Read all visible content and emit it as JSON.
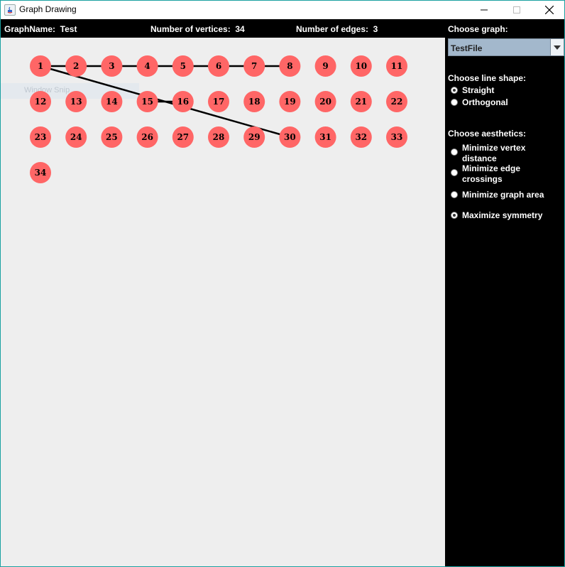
{
  "window": {
    "title": "Graph Drawing"
  },
  "info": {
    "graph_name": "GraphName:  Test",
    "vertices": "Number of vertices:  34",
    "edges": "Number of edges:  3"
  },
  "ghost": {
    "label": "Window Snip"
  },
  "panel": {
    "choose_graph": "Choose graph:",
    "graph_selected": "TestFile",
    "choose_line_shape": "Choose line shape:",
    "line_shapes": [
      {
        "label": "Straight",
        "checked": true
      },
      {
        "label": "Orthogonal",
        "checked": false
      }
    ],
    "choose_aesthetics": "Choose aesthetics:",
    "aesthetics": [
      {
        "label": "Minimize vertex distance",
        "checked": false
      },
      {
        "label": "Minimize edge crossings",
        "checked": false
      },
      {
        "label": "Minimize graph area",
        "checked": false
      },
      {
        "label": "Maximize symmetry",
        "checked": true
      }
    ]
  },
  "graph": {
    "vertex_color": "#ff6666",
    "edge_color": "#000000",
    "vertices": [
      "1",
      "2",
      "3",
      "4",
      "5",
      "6",
      "7",
      "8",
      "9",
      "10",
      "11",
      "12",
      "13",
      "14",
      "15",
      "16",
      "17",
      "18",
      "19",
      "20",
      "21",
      "22",
      "23",
      "24",
      "25",
      "26",
      "27",
      "28",
      "29",
      "30",
      "31",
      "32",
      "33",
      "34"
    ],
    "edges": [
      [
        "1",
        "8"
      ],
      [
        "1",
        "30"
      ],
      [
        "15",
        "16"
      ]
    ]
  }
}
